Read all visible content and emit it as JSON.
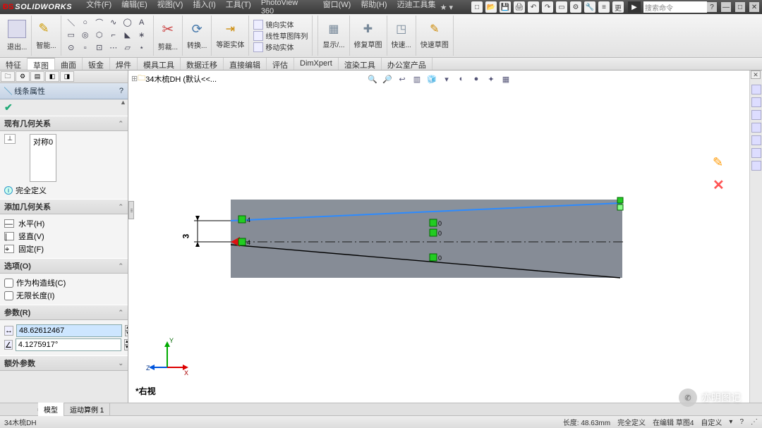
{
  "app": {
    "brand": "SOLIDWORKS"
  },
  "menu": [
    "文件(F)",
    "编辑(E)",
    "视图(V)",
    "插入(I)",
    "工具(T)",
    "PhotoView 360",
    "窗口(W)",
    "帮助(H)",
    "迈迪工具集"
  ],
  "search_placeholder": "搜索命令",
  "ribbon": {
    "exit": "退出...",
    "smart": "智能...",
    "trim": "剪裁...",
    "convert": "转换...",
    "offset_label": "等距实体",
    "mirror": "镜向实体",
    "linear": "线性草图阵列",
    "move": "移动实体",
    "display": "显示/...",
    "repair": "修复草图",
    "quick": "快速...",
    "quick2": "快速草图"
  },
  "tabs": [
    "特征",
    "草图",
    "曲面",
    "钣金",
    "焊件",
    "模具工具",
    "数据迁移",
    "直接编辑",
    "评估",
    "DimXpert",
    "渲染工具",
    "办公室产品"
  ],
  "active_tab": "草图",
  "doc": {
    "name": "34木梳DH  (默认<<..."
  },
  "panel": {
    "title": "线条属性",
    "sec_existing": "现有几何关系",
    "rel_item": "对称0",
    "status": "完全定义",
    "sec_add": "添加几何关系",
    "add": {
      "h": "水平(H)",
      "v": "竖直(V)",
      "f": "固定(F)"
    },
    "sec_opts": "选项(O)",
    "opt_construction": "作为构造线(C)",
    "opt_infinite": "无限长度(I)",
    "sec_params": "参数(R)",
    "param_len": "48.62612467",
    "param_ang": "4.1275917°",
    "sec_extra": "额外参数"
  },
  "sketch": {
    "dim_label": "3",
    "constraints": [
      "4",
      "4",
      "0",
      "0",
      "0"
    ],
    "view_name": "*右视"
  },
  "bottom_tabs": [
    "模型",
    "运动算例 1"
  ],
  "status": {
    "left": "34木梳DH",
    "length": "长度: 48.63mm",
    "def": "完全定义",
    "editing": "在编辑 草图4",
    "custom": "自定义"
  },
  "watermark": "亦明图记",
  "triad": {
    "x": "X",
    "y": "Y",
    "z": "Z"
  }
}
